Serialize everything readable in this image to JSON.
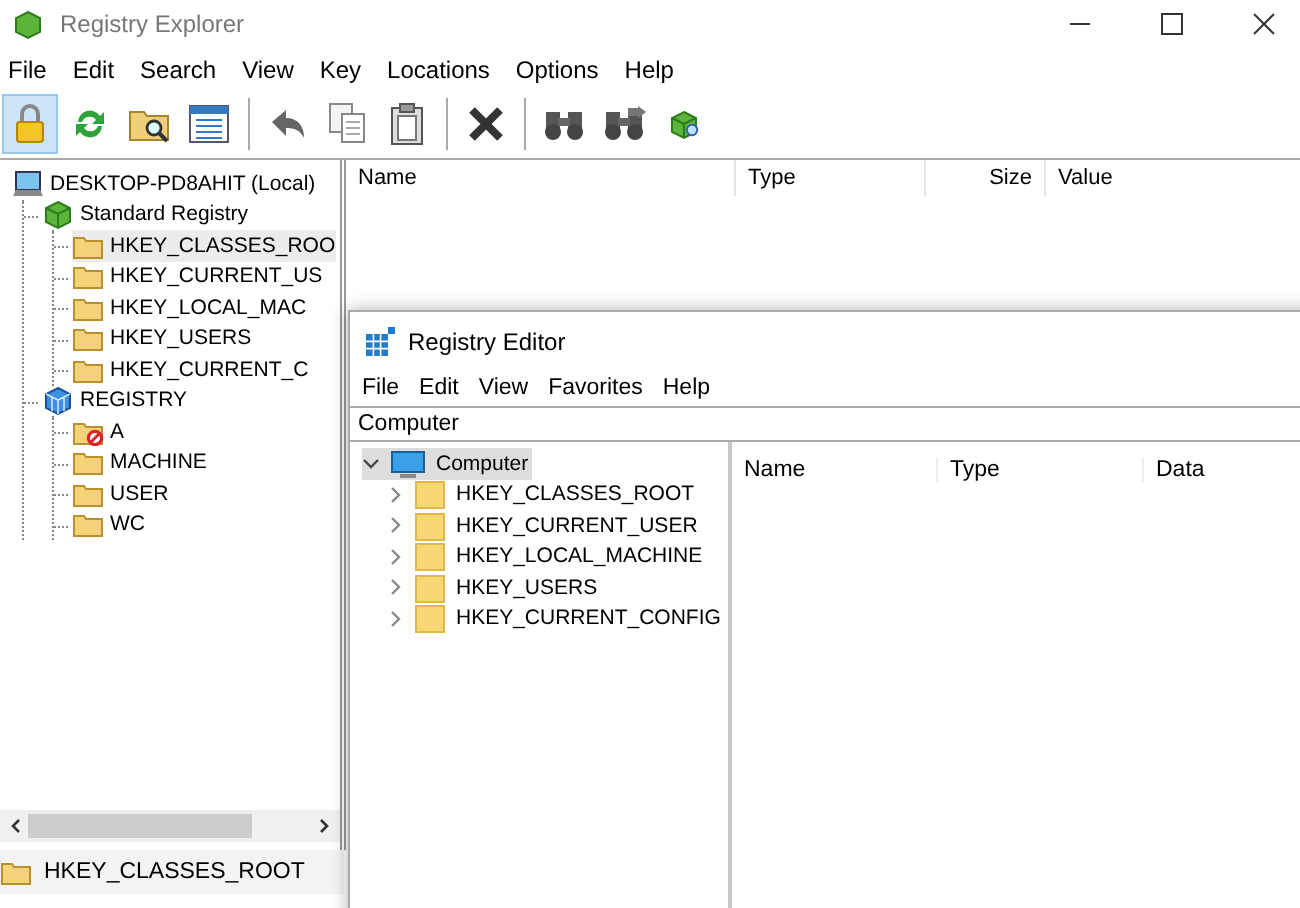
{
  "explorer": {
    "title": "Registry Explorer",
    "menu": [
      "File",
      "Edit",
      "Search",
      "View",
      "Key",
      "Locations",
      "Options",
      "Help"
    ],
    "toolbar": [
      [
        {
          "kind": "lock",
          "selected": true
        },
        {
          "kind": "refresh",
          "selected": false
        },
        {
          "kind": "folder-search",
          "selected": false
        },
        {
          "kind": "list",
          "selected": false
        }
      ],
      [
        {
          "kind": "undo",
          "selected": false
        },
        {
          "kind": "copy",
          "selected": false
        },
        {
          "kind": "paste",
          "selected": false
        }
      ],
      [
        {
          "kind": "delete",
          "selected": false
        }
      ],
      [
        {
          "kind": "find",
          "selected": false
        },
        {
          "kind": "find-next",
          "selected": false
        },
        {
          "kind": "cube-search",
          "selected": false
        }
      ]
    ],
    "tree": [
      {
        "label": "DESKTOP-PD8AHIT (Local)",
        "kind": "computer",
        "selected": false,
        "children": [
          {
            "label": "Standard Registry",
            "kind": "cube",
            "selected": false,
            "children": [
              {
                "label": "HKEY_CLASSES_ROO",
                "kind": "folder",
                "selected": true
              },
              {
                "label": "HKEY_CURRENT_US",
                "kind": "folder",
                "selected": false
              },
              {
                "label": "HKEY_LOCAL_MAC",
                "kind": "folder",
                "selected": false
              },
              {
                "label": "HKEY_USERS",
                "kind": "folder",
                "selected": false
              },
              {
                "label": "HKEY_CURRENT_C",
                "kind": "folder",
                "selected": false
              }
            ]
          },
          {
            "label": "REGISTRY",
            "kind": "cube-grid",
            "selected": false,
            "children": [
              {
                "label": "A",
                "kind": "folder-blocked",
                "selected": false
              },
              {
                "label": "MACHINE",
                "kind": "folder",
                "selected": false
              },
              {
                "label": "USER",
                "kind": "folder",
                "selected": false
              },
              {
                "label": "WC",
                "kind": "folder",
                "selected": false
              }
            ]
          }
        ]
      }
    ],
    "columns": [
      "Name",
      "Type",
      "Size",
      "Value"
    ],
    "status_bar": {
      "label": "HKEY_CLASSES_ROOT"
    }
  },
  "registry_editor": {
    "title": "Registry Editor",
    "menu": [
      "File",
      "Edit",
      "View",
      "Favorites",
      "Help"
    ],
    "address": "Computer",
    "tree": [
      {
        "label": "Computer",
        "kind": "computer",
        "selected": true,
        "expanded": true,
        "children": [
          {
            "label": "HKEY_CLASSES_ROOT",
            "kind": "folder",
            "selected": false,
            "expanded": false
          },
          {
            "label": "HKEY_CURRENT_USER",
            "kind": "folder",
            "selected": false,
            "expanded": false
          },
          {
            "label": "HKEY_LOCAL_MACHINE",
            "kind": "folder",
            "selected": false,
            "expanded": false
          },
          {
            "label": "HKEY_USERS",
            "kind": "folder",
            "selected": false,
            "expanded": false
          },
          {
            "label": "HKEY_CURRENT_CONFIG",
            "kind": "folder",
            "selected": false,
            "expanded": false
          }
        ]
      }
    ],
    "columns": [
      "Name",
      "Type",
      "Data"
    ]
  }
}
